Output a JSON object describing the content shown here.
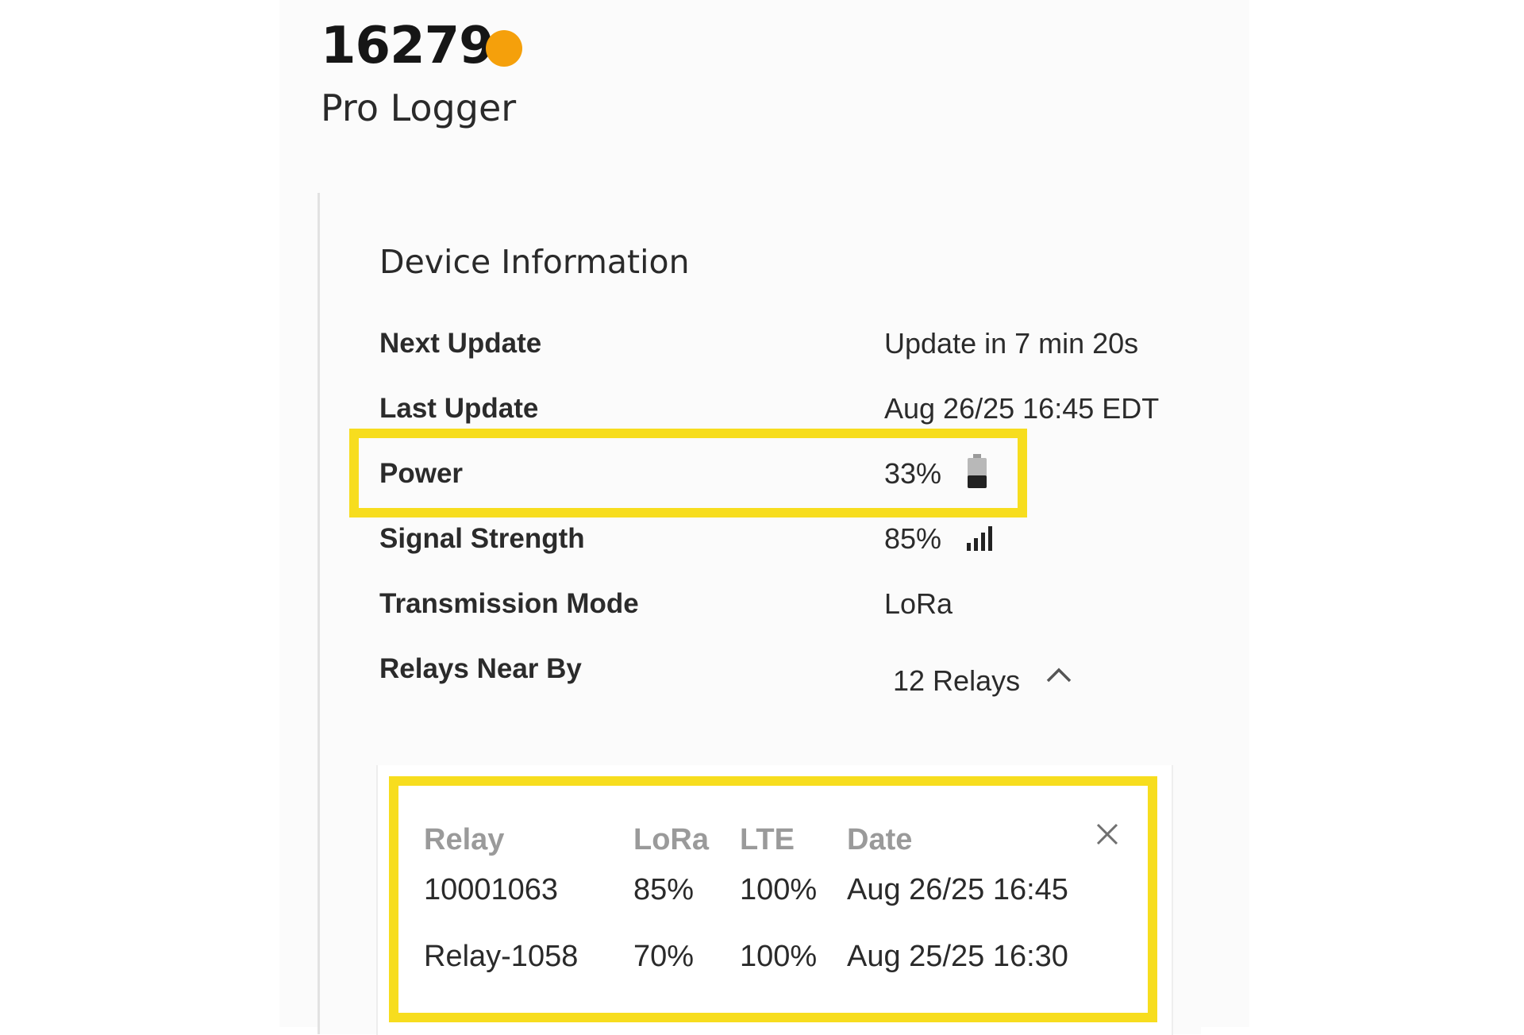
{
  "device": {
    "id": "16279",
    "model": "Pro Logger",
    "status_color": "#f5a00b"
  },
  "info": {
    "title": "Device Information",
    "next_update": {
      "label": "Next Update",
      "value": "Update in 7 min 20s"
    },
    "last_update": {
      "label": "Last Update",
      "value": "Aug 26/25 16:45 EDT"
    },
    "power": {
      "label": "Power",
      "value": "33%",
      "icon": "battery-icon"
    },
    "signal": {
      "label": "Signal Strength",
      "value": "85%",
      "icon": "signal-bars-icon"
    },
    "mode": {
      "label": "Transmission Mode",
      "value": "LoRa"
    },
    "relays": {
      "label": "Relays Near By",
      "value": "12 Relays",
      "icon": "chevron-up-icon"
    }
  },
  "relay_table": {
    "headers": [
      "Relay",
      "LoRa",
      "LTE",
      "Date"
    ],
    "rows": [
      [
        "10001063",
        "85%",
        "100%",
        "Aug 26/25 16:45"
      ],
      [
        "Relay-1058",
        "70%",
        "100%",
        "Aug 25/25 16:30"
      ]
    ],
    "close_icon": "close-icon"
  },
  "colors": {
    "highlight": "#f7dd1e",
    "status_dot": "#f5a00b"
  }
}
